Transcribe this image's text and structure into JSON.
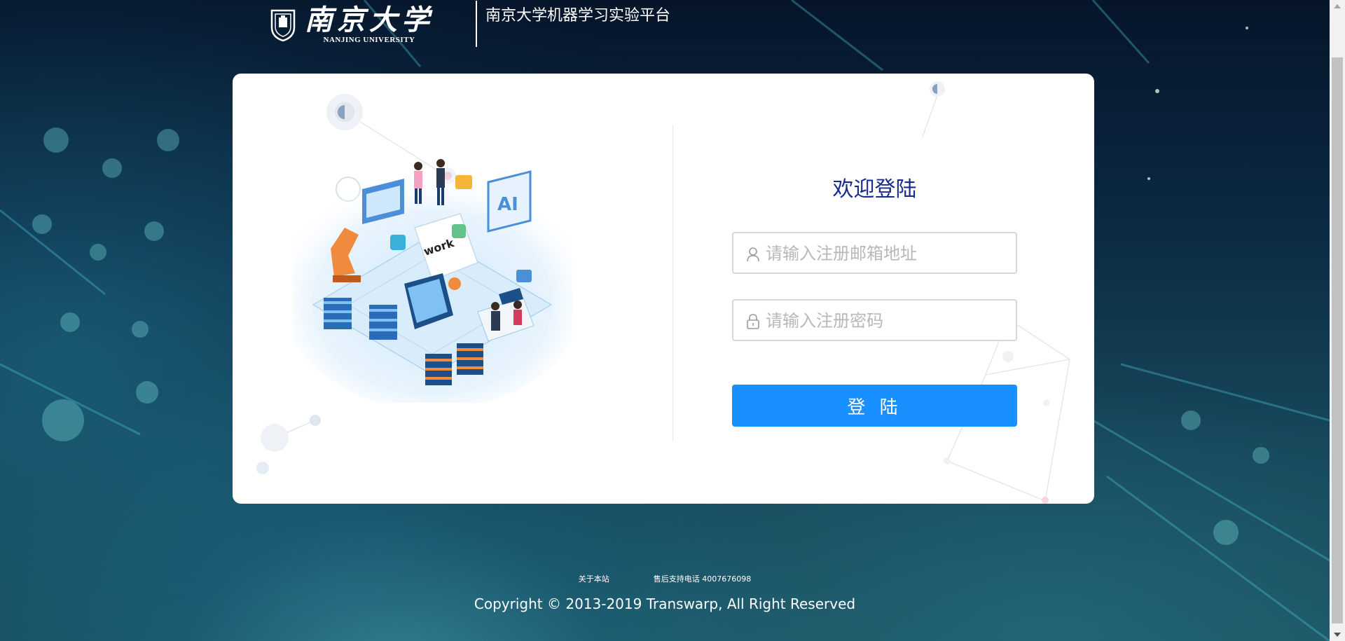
{
  "header": {
    "logo_cn": "南京大学",
    "logo_en": "NANJING UNIVERSITY",
    "platform_title": "南京大学机器学习实验平台"
  },
  "illustration": {
    "work_text": "work",
    "ai_text": "AI"
  },
  "login": {
    "welcome": "欢迎登陆",
    "email_placeholder": "请输入注册邮箱地址",
    "password_placeholder": "请输入注册密码",
    "submit_label": "登 陆"
  },
  "footer": {
    "about_link": "关于本站",
    "support_text": "售后支持电话 4007676098",
    "copyright": "Copyright © 2013-2019 Transwarp, All Right Reserved"
  },
  "colors": {
    "accent": "#1890ff",
    "welcome": "#1a2a8c",
    "card": "#ffffff"
  },
  "icons": {
    "user": "user-icon",
    "lock": "lock-icon",
    "seal": "university-seal-icon"
  }
}
